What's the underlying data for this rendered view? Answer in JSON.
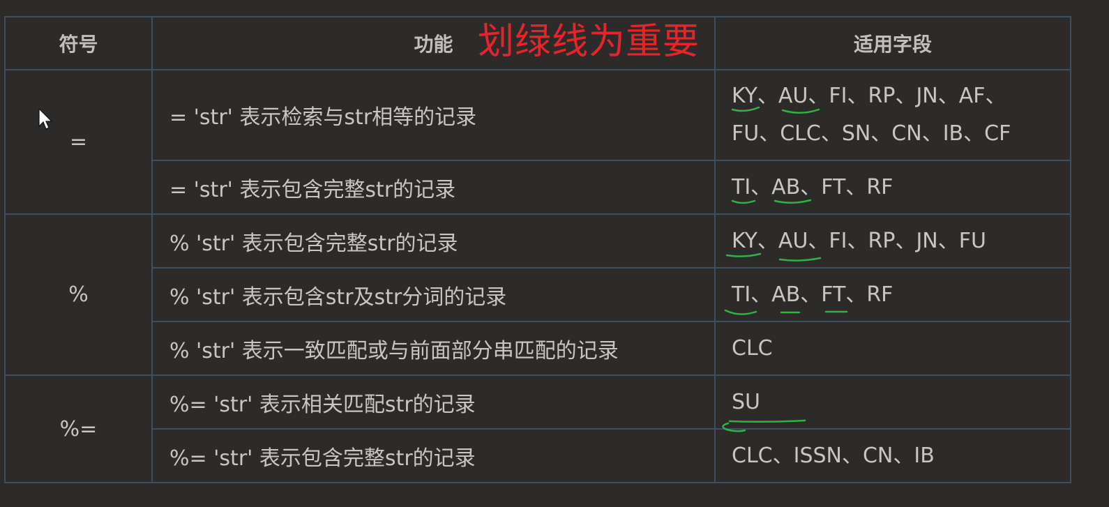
{
  "header": {
    "symbol": "符号",
    "function": "功能",
    "fields": "适用字段",
    "note": "划绿线为重要"
  },
  "rows": [
    {
      "symbol": "=",
      "function": "= 'str' 表示检索与str相等的记录",
      "line1": "KY、AU、FI、RP、JN、AF、",
      "line2": "FU、CLC、SN、CN、IB、CF"
    },
    {
      "function": "= 'str' 表示包含完整str的记录",
      "fields": "TI、AB、FT、RF"
    },
    {
      "symbol": "%",
      "function": "% 'str' 表示包含完整str的记录",
      "fields": "KY、AU、FI、RP、JN、FU"
    },
    {
      "function": "% 'str' 表示包含str及str分词的记录",
      "fields": "TI、AB、FT、RF"
    },
    {
      "function": "% 'str' 表示一致匹配或与前面部分串匹配的记录",
      "fields": "CLC"
    },
    {
      "symbol": "%=",
      "function": "%= 'str' 表示相关匹配str的记录",
      "fields": "SU"
    },
    {
      "function": "%= 'str' 表示包含完整str的记录",
      "fields": "CLC、ISSN、CN、IB"
    }
  ],
  "colors": {
    "background": "#2c2b2a",
    "grid": "#3d4f63",
    "text": "#c9c6c0",
    "note": "#e5252a",
    "highlight": "#2fb344"
  }
}
